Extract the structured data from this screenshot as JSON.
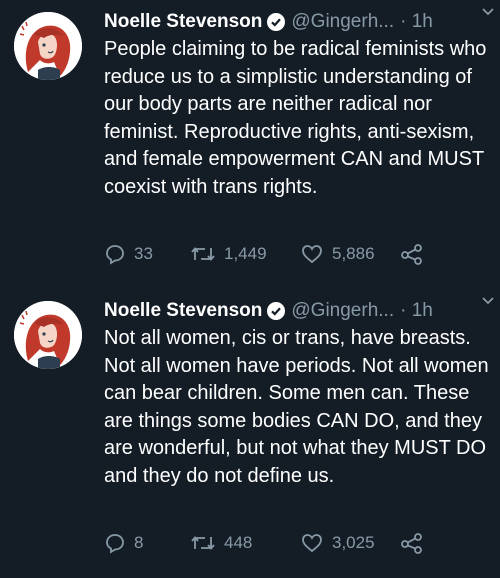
{
  "tweets": [
    {
      "author": "Noelle Stevenson",
      "handle": "@Gingerh...",
      "time": "· 1h",
      "text": "People claiming to be radical feminists who reduce us to a simplistic understanding of our body parts are neither radical nor feminist. Reproductive rights, anti-sexism, and female empowerment CAN and MUST coexist with trans rights.",
      "replies": "33",
      "retweets": "1,449",
      "likes": "5,886"
    },
    {
      "author": "Noelle Stevenson",
      "handle": "@Gingerh...",
      "time": "· 1h",
      "text": "Not all women, cis or trans, have breasts. Not all women have periods. Not all women can bear children. Some men can. These are things some bodies CAN DO, and they are wonderful, but not what they MUST DO and they do not define us.",
      "replies": "8",
      "retweets": "448",
      "likes": "3,025"
    }
  ],
  "icons": {
    "reply": "comment-icon",
    "retweet": "retweet-icon",
    "like": "heart-icon",
    "share": "share-icon",
    "verified": "verified-badge-icon",
    "menu": "chevron-down-icon"
  },
  "colors": {
    "background": "#141d26",
    "text": "#ffffff",
    "muted": "#8899a6"
  }
}
